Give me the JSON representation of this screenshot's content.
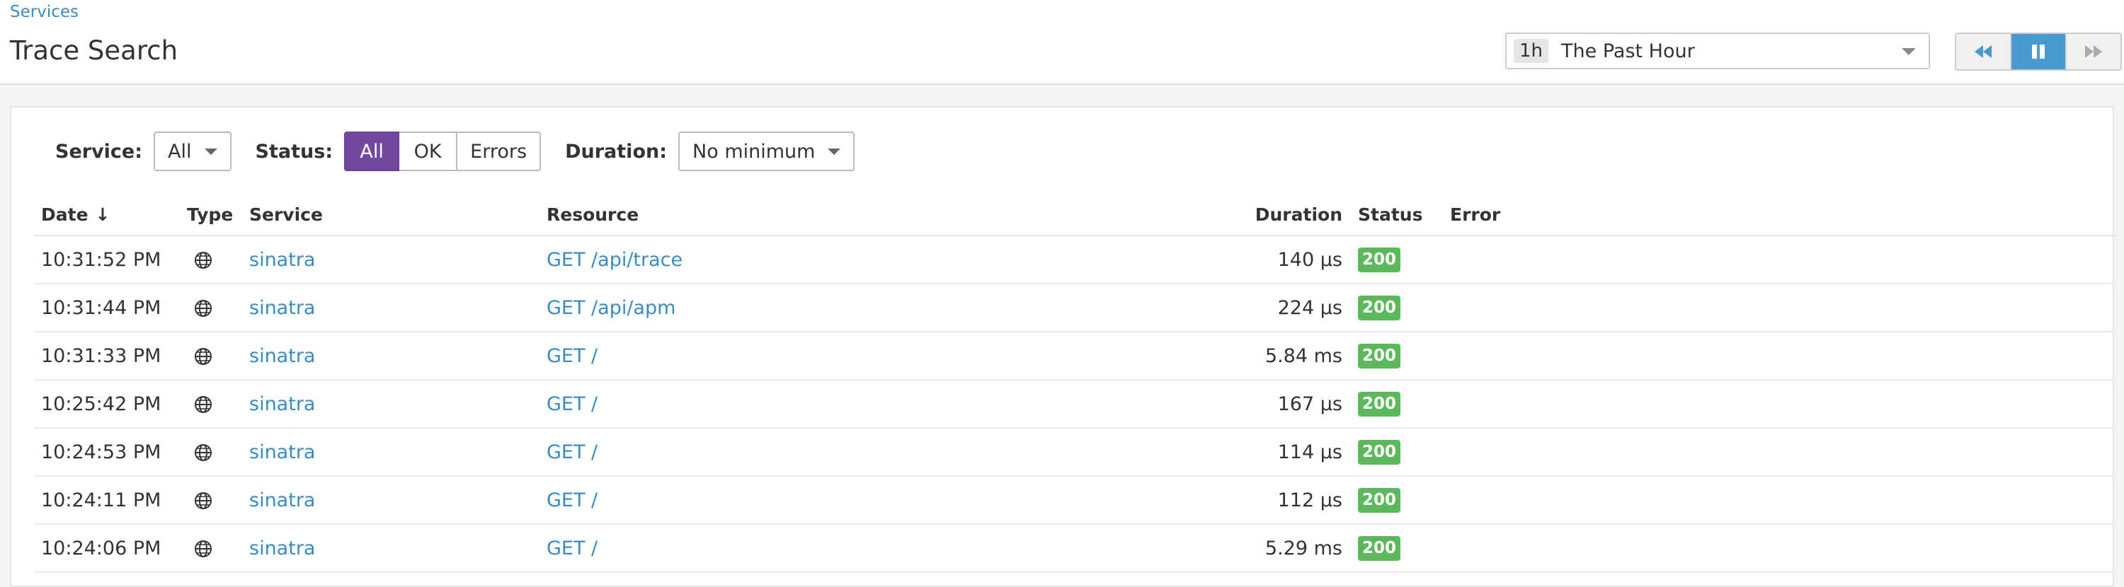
{
  "header": {
    "breadcrumb": "Services",
    "title": "Trace Search",
    "timeframe": {
      "abbr": "1h",
      "label": "The Past Hour"
    }
  },
  "player": {
    "buttons": [
      {
        "icon": "rewind-icon",
        "active": false
      },
      {
        "icon": "pause-icon",
        "active": true
      },
      {
        "icon": "fast-forward-icon",
        "active": false
      }
    ]
  },
  "filters": {
    "service_label": "Service:",
    "service_value": "All",
    "status_label": "Status:",
    "status_options": [
      "All",
      "OK",
      "Errors"
    ],
    "status_selected": "All",
    "duration_label": "Duration:",
    "duration_value": "No minimum"
  },
  "table": {
    "columns": [
      "Date",
      "Type",
      "Service",
      "Resource",
      "Duration",
      "Status",
      "Error"
    ],
    "sort_indicator": "↓",
    "rows": [
      {
        "date": "10:31:52 PM",
        "type": "globe-icon",
        "service": "sinatra",
        "resource": "GET /api/trace",
        "duration": "140 μs",
        "status": "200",
        "error": ""
      },
      {
        "date": "10:31:44 PM",
        "type": "globe-icon",
        "service": "sinatra",
        "resource": "GET /api/apm",
        "duration": "224 μs",
        "status": "200",
        "error": ""
      },
      {
        "date": "10:31:33 PM",
        "type": "globe-icon",
        "service": "sinatra",
        "resource": "GET /",
        "duration": "5.84 ms",
        "status": "200",
        "error": ""
      },
      {
        "date": "10:25:42 PM",
        "type": "globe-icon",
        "service": "sinatra",
        "resource": "GET /",
        "duration": "167 μs",
        "status": "200",
        "error": ""
      },
      {
        "date": "10:24:53 PM",
        "type": "globe-icon",
        "service": "sinatra",
        "resource": "GET /",
        "duration": "114 μs",
        "status": "200",
        "error": ""
      },
      {
        "date": "10:24:11 PM",
        "type": "globe-icon",
        "service": "sinatra",
        "resource": "GET /",
        "duration": "112 μs",
        "status": "200",
        "error": ""
      },
      {
        "date": "10:24:06 PM",
        "type": "globe-icon",
        "service": "sinatra",
        "resource": "GET /",
        "duration": "5.29 ms",
        "status": "200",
        "error": ""
      }
    ]
  },
  "colors": {
    "link": "#3a8bc4",
    "accent_purple": "#73479d",
    "status_ok": "#5cb85c",
    "player_active": "#4a98d0"
  }
}
